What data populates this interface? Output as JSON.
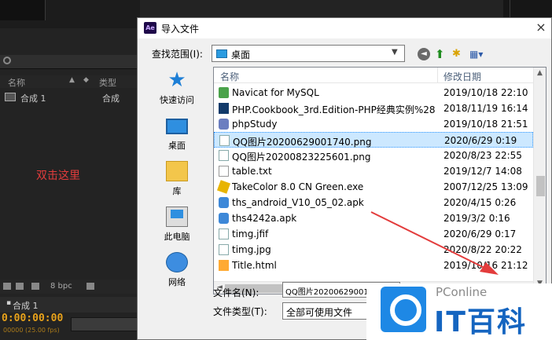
{
  "ae": {
    "header_name": "名称",
    "header_type": "类型",
    "project_item_name": "合成 1",
    "project_item_type": "合成",
    "annotation": "双击这里",
    "bpc": "8 bpc",
    "timeline_tab": "合成 1",
    "timecode": "0:00:00:00",
    "timecode_sub": "00000 (25.00 fps)"
  },
  "dialog": {
    "app_badge": "Ae",
    "title": "导入文件",
    "close_glyph": "×",
    "lookin_label": "查找范围(I):",
    "lookin_value": "桌面",
    "places": [
      {
        "label": "快速访问",
        "icon": "star-icon"
      },
      {
        "label": "桌面",
        "icon": "desktop-icon"
      },
      {
        "label": "库",
        "icon": "library-icon"
      },
      {
        "label": "此电脑",
        "icon": "computer-icon"
      },
      {
        "label": "网络",
        "icon": "network-icon"
      }
    ],
    "columns": {
      "name": "名称",
      "date": "修改日期"
    },
    "files": [
      {
        "name": "Navicat for MySQL",
        "date": "2019/10/18 22:10",
        "icon": "app"
      },
      {
        "name": "PHP.Cookbook_3rd.Edition-PHP经典实例%28...",
        "date": "2018/11/19 16:14",
        "icon": "book"
      },
      {
        "name": "phpStudy",
        "date": "2019/10/18 21:51",
        "icon": "php"
      },
      {
        "name": "QQ图片20200629001740.png",
        "date": "2020/6/29 0:19",
        "icon": "img"
      },
      {
        "name": "QQ图片20200823225601.png",
        "date": "2020/8/23 22:55",
        "icon": "img"
      },
      {
        "name": "table.txt",
        "date": "2019/12/7 14:08",
        "icon": "txt"
      },
      {
        "name": "TakeColor 8.0 CN Green.exe",
        "date": "2007/12/25 13:09",
        "icon": "tc"
      },
      {
        "name": "ths_android_V10_05_02.apk",
        "date": "2020/4/15 0:26",
        "icon": "apk"
      },
      {
        "name": "ths4242a.apk",
        "date": "2019/3/2 0:16",
        "icon": "apk"
      },
      {
        "name": "timg.jfif",
        "date": "2020/6/29 0:17",
        "icon": "img"
      },
      {
        "name": "timg.jpg",
        "date": "2020/8/22 20:22",
        "icon": "img"
      },
      {
        "name": "Title.html",
        "date": "2019/10/16 21:12",
        "icon": "html"
      }
    ],
    "selected_index": 3,
    "filename_label": "文件名(N):",
    "filename_value": "QQ图片20200629001",
    "filetype_label": "文件类型(T):",
    "filetype_value": "全部可使用文件"
  },
  "watermark": {
    "brand": "PConline",
    "big": "IT百科"
  },
  "colors": {
    "accent": "#3399ff",
    "annotation_red": "#e33c3c",
    "timecode": "#e8a21b"
  }
}
